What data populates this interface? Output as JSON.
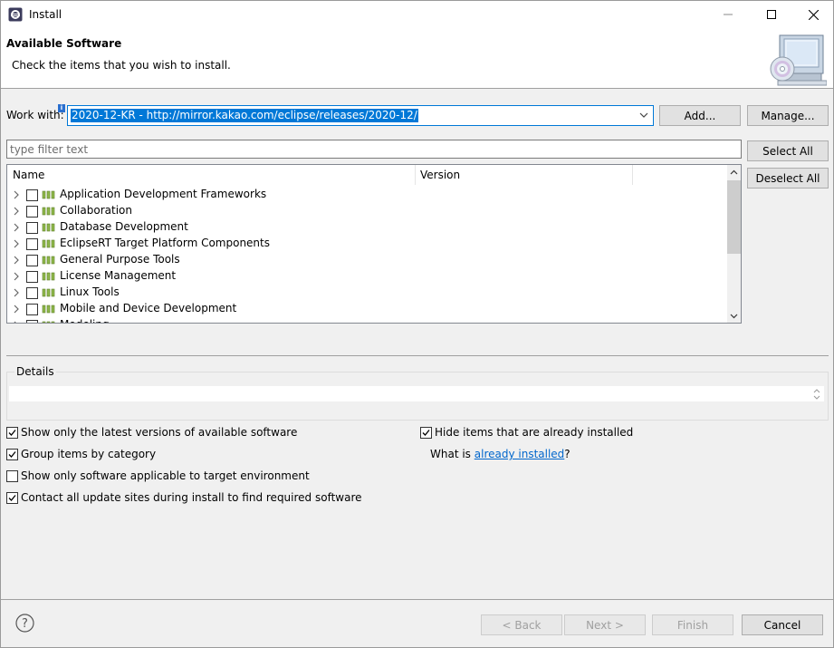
{
  "window": {
    "title": "Install"
  },
  "header": {
    "title": "Available Software",
    "description": "Check the items that you wish to install."
  },
  "work_with": {
    "label": "Work with:",
    "value": "2020-12-KR - http://mirror.kakao.com/eclipse/releases/2020-12/",
    "add_label": "Add...",
    "manage_label": "Manage..."
  },
  "filter": {
    "placeholder": "type filter text"
  },
  "side_buttons": {
    "select_all": "Select All",
    "deselect_all": "Deselect All"
  },
  "table": {
    "columns": [
      "Name",
      "Version"
    ],
    "rows": [
      {
        "name": "Application Development Frameworks",
        "version": "",
        "checked": false
      },
      {
        "name": "Collaboration",
        "version": "",
        "checked": false
      },
      {
        "name": "Database Development",
        "version": "",
        "checked": false
      },
      {
        "name": "EclipseRT Target Platform Components",
        "version": "",
        "checked": false
      },
      {
        "name": "General Purpose Tools",
        "version": "",
        "checked": false
      },
      {
        "name": "License Management",
        "version": "",
        "checked": false
      },
      {
        "name": "Linux Tools",
        "version": "",
        "checked": false
      },
      {
        "name": "Mobile and Device Development",
        "version": "",
        "checked": false
      },
      {
        "name": "Modeling",
        "version": "",
        "checked": false
      }
    ]
  },
  "details": {
    "label": "Details",
    "text": ""
  },
  "options": {
    "latest_versions": {
      "label": "Show only the latest versions of available software",
      "checked": true
    },
    "group_by_category": {
      "label": "Group items by category",
      "checked": true
    },
    "target_env": {
      "label": "Show only software applicable to target environment",
      "checked": false
    },
    "contact_sites": {
      "label": "Contact all update sites during install to find required software",
      "checked": true
    },
    "hide_installed": {
      "label": "Hide items that are already installed",
      "checked": true
    },
    "what_is_prefix": "What is ",
    "what_is_link": "already installed",
    "what_is_suffix": "?"
  },
  "footer": {
    "back": "< Back",
    "next": "Next >",
    "finish": "Finish",
    "cancel": "Cancel"
  },
  "icons": {
    "app": "eclipse-icon",
    "help": "help-icon",
    "header_image": "install-computer-cd-icon",
    "category": "feature-category-icon"
  },
  "colors": {
    "selection": "#0078d7",
    "link": "#0066cc"
  }
}
